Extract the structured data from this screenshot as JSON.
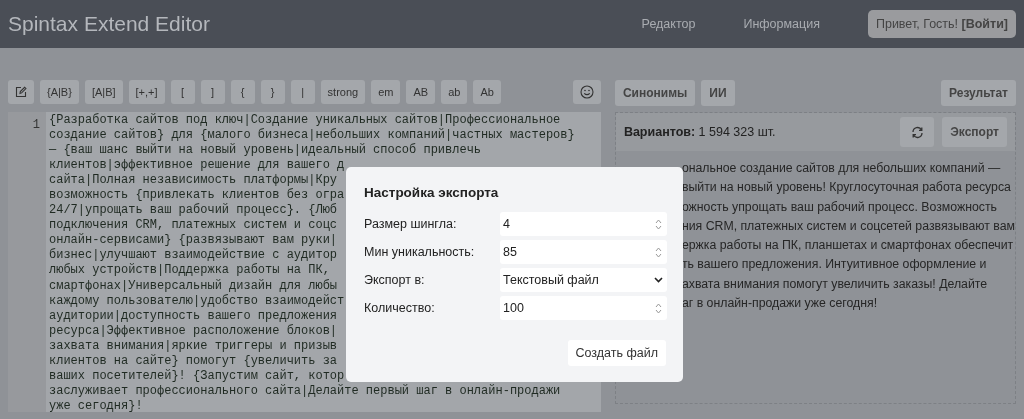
{
  "header": {
    "title": "Spintax Extend Editor",
    "nav": [
      "Редактор",
      "Информация"
    ],
    "login": "Привет, Гость! **[Войти]**"
  },
  "toolbar": [
    {
      "kind": "icon"
    },
    {
      "kind": "text",
      "label": "{A|B}"
    },
    {
      "kind": "text",
      "label": "[A|B]"
    },
    {
      "kind": "text",
      "label": "[+,+]"
    },
    {
      "kind": "text",
      "label": "["
    },
    {
      "kind": "text",
      "label": "]"
    },
    {
      "kind": "text",
      "label": "{"
    },
    {
      "kind": "text",
      "label": "}"
    },
    {
      "kind": "text",
      "label": "|"
    },
    {
      "kind": "text",
      "label": "strong"
    },
    {
      "kind": "text",
      "label": "em"
    },
    {
      "kind": "text",
      "label": "AB"
    },
    {
      "kind": "text",
      "label": "ab"
    },
    {
      "kind": "text",
      "label": "Ab"
    }
  ],
  "editor": {
    "line_number": "1",
    "lines": [
      "{Разработка сайтов под ключ|Создание уникальных сайтов|Профессиональное",
      "создание сайтов} для {малого бизнеса|небольших компаний|частных мастеров}",
      "— {ваш шанс выйти на новый уровень|идеальный способ привлечь",
      "клиентов|эффективное решение для вашего д",
      "сайта|Полная независимость платформы|Кру",
      "возможность {привлекать клиентов без огра",
      "24/7|упрощать ваш рабочий процесс}. {Люб",
      "подключения CRM, платежных систем и соцс",
      "онлайн-сервисами} {развязывают вам руки|",
      "бизнес|улучшают взаимодействие с аудитор",
      "любых устройств|Поддержка работы на ПК,",
      "смартфонах|Универсальный дизайн для любы",
      "каждому пользователю|удобство взаимодейст",
      "аудитории|доступность вашего предложения",
      "ресурса|Эффективное расположение блоков|",
      "захвата внимания|яркие триггеры и призыв",
      "клиентов на сайте} помогут {увеличить за",
      "ваших посетителей}! {Запустим сайт, котор",
      "заслуживает профессионального сайта|Делайте первый шаг в онлайн-продажи",
      "уже сегодня}!"
    ]
  },
  "right_tabs": [
    "Синонимы",
    "ИИ"
  ],
  "result_button": "Результат",
  "result": {
    "variants": "**Вариантов:** 1 594 323 шт.",
    "export_button": "Экспорт",
    "lines": [
      "ональное создание сайтов для небольших компаний —",
      "выйти на новый уровень! Круглосуточная работа ресурса",
      "ожность упрощать ваш рабочий процесс. Возможность",
      "ния CRM, платежных систем и соцсетей развязывают вам",
      "ержка работы на ПК, планшетах и смартфонах обеспечит",
      "ть вашего предложения. Интуитивное оформление и",
      "ахвата внимания помогут увеличить заказы! Делайте",
      "аг в онлайн-продажи уже сегодня!"
    ]
  },
  "modal": {
    "title": "Настройка экспорта",
    "fields": [
      {
        "kind": "number",
        "label": "Размер шингла:",
        "value": "4"
      },
      {
        "kind": "number",
        "label": "Мин уникальность:",
        "value": "85"
      },
      {
        "kind": "select",
        "label": "Экспорт в:",
        "value": "Текстовый файл"
      },
      {
        "kind": "number",
        "label": "Количество:",
        "value": "100"
      }
    ],
    "button": "Создать файл"
  }
}
